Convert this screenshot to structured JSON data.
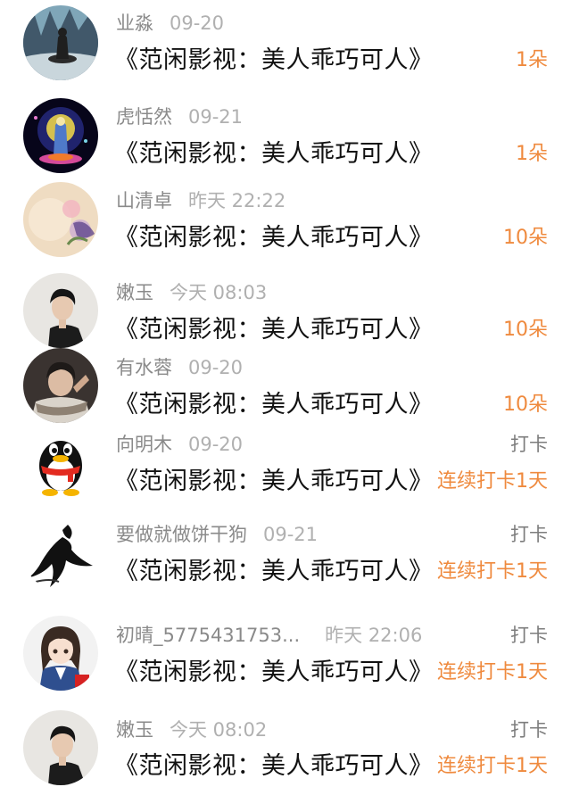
{
  "colors": {
    "reward_accent": "#ef8a3e",
    "name_gray": "#8a8a8a",
    "time_gray": "#b0b0b0",
    "title_black": "#111111"
  },
  "items": [
    {
      "avatar": "avatar-landscape-figure",
      "name": "业淼",
      "time": "09-20",
      "title": "《范闲影视：美人乖巧可人》",
      "reward": "1朵",
      "tag": ""
    },
    {
      "avatar": "avatar-buddha-lotus",
      "name": "虎恬然",
      "time": "09-21",
      "title": "《范闲影视：美人乖巧可人》",
      "reward": "1朵",
      "tag": ""
    },
    {
      "avatar": "avatar-flower-painting",
      "name": "山清卓",
      "time": "昨天 22:22",
      "title": "《范闲影视：美人乖巧可人》",
      "reward": "10朵",
      "tag": ""
    },
    {
      "avatar": "avatar-man-portrait",
      "name": "嫩玉",
      "time": "今天 08:03",
      "title": "《范闲影视：美人乖巧可人》",
      "reward": "10朵",
      "tag": ""
    },
    {
      "avatar": "avatar-man-scarf",
      "name": "有水蓉",
      "time": "09-20",
      "title": "《范闲影视：美人乖巧可人》",
      "reward": "10朵",
      "tag": ""
    },
    {
      "avatar": "avatar-qq-penguin",
      "name": "向明木",
      "time": "09-20",
      "title": "《范闲影视：美人乖巧可人》",
      "reward": "连续打卡1天",
      "tag": "打卡"
    },
    {
      "avatar": "avatar-ink-silhouette",
      "name": "要做就做饼干狗",
      "time": "09-21",
      "title": "《范闲影视：美人乖巧可人》",
      "reward": "连续打卡1天",
      "tag": "打卡"
    },
    {
      "avatar": "avatar-anime-girl",
      "name": "初晴_5775431753...",
      "time": "昨天 22:06",
      "title": "《范闲影视：美人乖巧可人》",
      "reward": "连续打卡1天",
      "tag": "打卡"
    },
    {
      "avatar": "avatar-man-portrait",
      "name": "嫩玉",
      "time": "今天 08:02",
      "title": "《范闲影视：美人乖巧可人》",
      "reward": "连续打卡1天",
      "tag": "打卡"
    }
  ]
}
